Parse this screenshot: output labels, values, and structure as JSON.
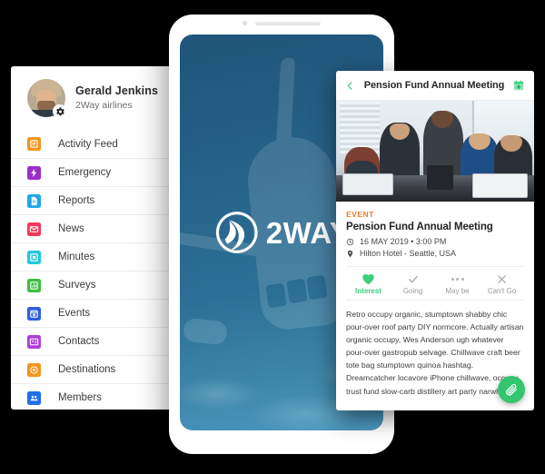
{
  "sidebar": {
    "profile": {
      "name": "Gerald Jenkins",
      "company": "2Way airlines",
      "avatar_icon": "user-avatar-photo",
      "settings_icon": "gear-icon"
    },
    "items": [
      {
        "label": "Activity Feed",
        "icon": "list-icon",
        "color": "#f5941f"
      },
      {
        "label": "Emergency",
        "icon": "bolt-icon",
        "color": "#9b2fc9"
      },
      {
        "label": "Reports",
        "icon": "document-icon",
        "color": "#1fa7e8"
      },
      {
        "label": "News",
        "icon": "envelope-icon",
        "color": "#f2385a"
      },
      {
        "label": "Minutes",
        "icon": "note-icon",
        "color": "#21c7dd"
      },
      {
        "label": "Surveys",
        "icon": "chart-icon",
        "color": "#3fbf3f"
      },
      {
        "label": "Events",
        "icon": "calendar-icon",
        "color": "#2f5fe0"
      },
      {
        "label": "Contacts",
        "icon": "contact-card-icon",
        "color": "#b13fd8"
      },
      {
        "label": "Destinations",
        "icon": "compass-icon",
        "color": "#f5941f"
      },
      {
        "label": "Members",
        "icon": "people-icon",
        "color": "#1f6fe8"
      }
    ]
  },
  "phone": {
    "splash": {
      "brand_name": "2WAY",
      "logo_icon": "2way-swoosh-logo",
      "background_icon": "airplane-silhouette",
      "background_color": "#2a6a91"
    },
    "camera_icon": "front-camera-dot",
    "speaker_icon": "earpiece-speaker"
  },
  "event_card": {
    "header": {
      "back_icon": "chevron-left-icon",
      "title": "Pension Fund Annual Meeting",
      "add_to_calendar_icon": "calendar-add-icon",
      "accent_color": "#3ecf7e"
    },
    "photo_icon": "business-meeting-photo",
    "kicker": "EVENT",
    "kicker_color": "#f07c2a",
    "name": "Pension Fund Annual Meeting",
    "datetime": "16 MAY 2019 • 3:00 PM",
    "datetime_icon": "clock-icon",
    "location": "Hilton Hotel - Seattle, USA",
    "location_icon": "map-pin-icon",
    "actions": [
      {
        "label": "Interest",
        "icon": "heart-icon",
        "active": true
      },
      {
        "label": "Going",
        "icon": "check-icon",
        "active": false
      },
      {
        "label": "May be",
        "icon": "ellipsis-icon",
        "active": false
      },
      {
        "label": "Can't Go",
        "icon": "close-x-icon",
        "active": false
      }
    ],
    "description": "Retro occupy organic, stumptown shabby chic pour-over roof party DIY normcore. Actually artisan organic occupy, Wes Anderson ugh whatever pour-over gastropub selvage. Chillwave craft beer tote bag stumptown quinoa hashtag. Dreamcatcher locavore iPhone chillwave, occupy trust fund slow-carb distillery art party narwhal.",
    "attach_button": {
      "icon": "paperclip-icon",
      "color": "#35c46f"
    }
  }
}
